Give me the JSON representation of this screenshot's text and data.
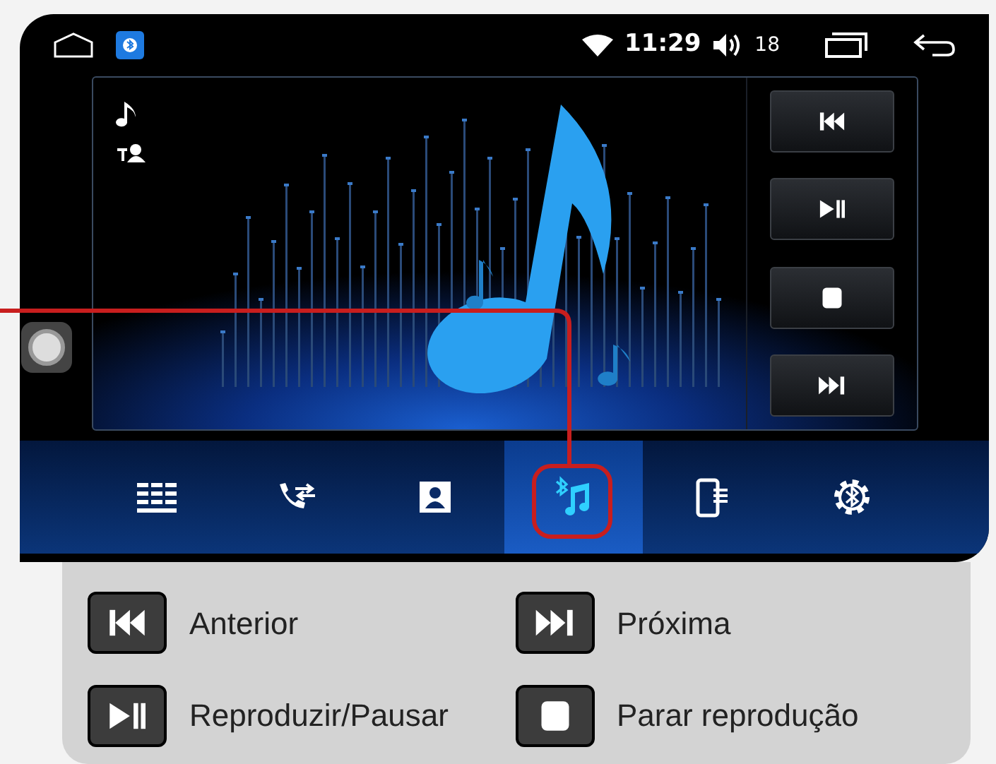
{
  "status_bar": {
    "time": "11:29",
    "volume": "18"
  },
  "player": {
    "controls": [
      {
        "kind": "previous"
      },
      {
        "kind": "play_pause"
      },
      {
        "kind": "stop"
      },
      {
        "kind": "next"
      }
    ]
  },
  "nav_tabs": [
    {
      "kind": "keypad",
      "selected": false
    },
    {
      "kind": "call_transfer",
      "selected": false
    },
    {
      "kind": "contacts",
      "selected": false
    },
    {
      "kind": "bluetooth_music",
      "selected": true
    },
    {
      "kind": "phone_list",
      "selected": false
    },
    {
      "kind": "bluetooth_settings",
      "selected": false
    }
  ],
  "legend": [
    {
      "kind": "previous",
      "label": "Anterior"
    },
    {
      "kind": "next",
      "label": "Próxima"
    },
    {
      "kind": "play_pause",
      "label": "Reproduzir/Pausar"
    },
    {
      "kind": "stop",
      "label": "Parar reprodução"
    }
  ]
}
